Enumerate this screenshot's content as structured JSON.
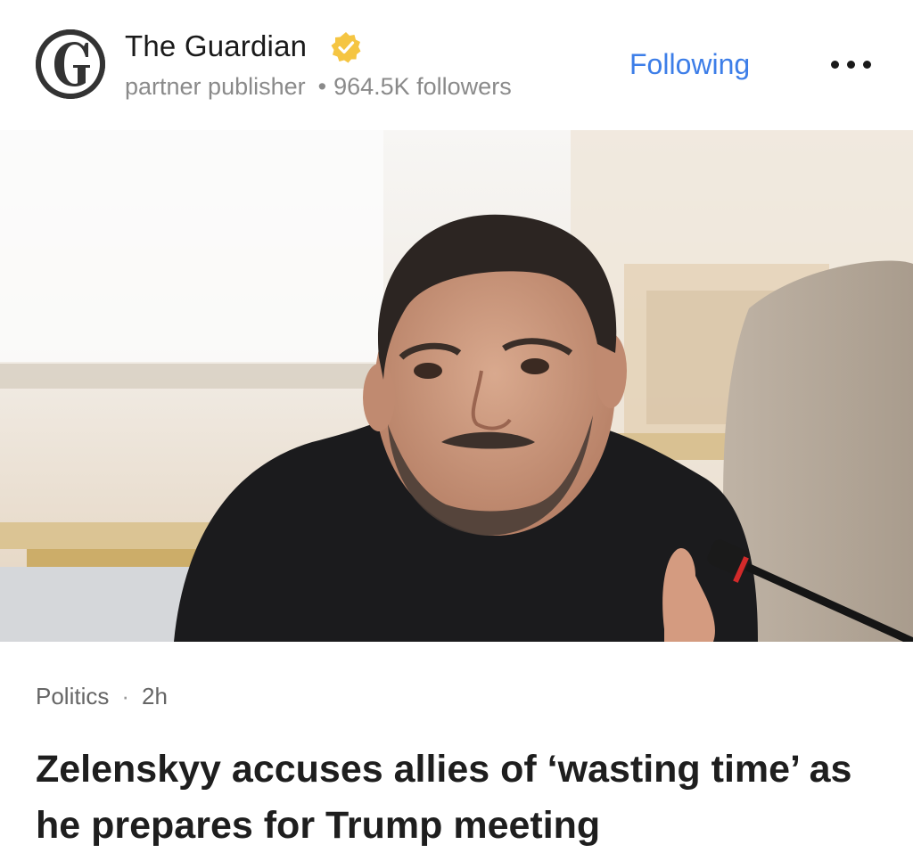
{
  "publisher": {
    "name": "The Guardian",
    "logo_icon": "guardian-g-logo",
    "verified_icon": "verified-badge-icon",
    "verified_color": "#f5c542",
    "type": "partner publisher",
    "separator": "•",
    "followers": "964.5K followers"
  },
  "actions": {
    "follow_label": "Following",
    "follow_color": "#3d7ee8",
    "more_icon": "more-horizontal-icon"
  },
  "article": {
    "category": "Politics",
    "separator": "·",
    "time": "2h",
    "headline": "Zelenskyy accuses allies of ‘wasting time’ as he prepares for Trump meeting"
  }
}
